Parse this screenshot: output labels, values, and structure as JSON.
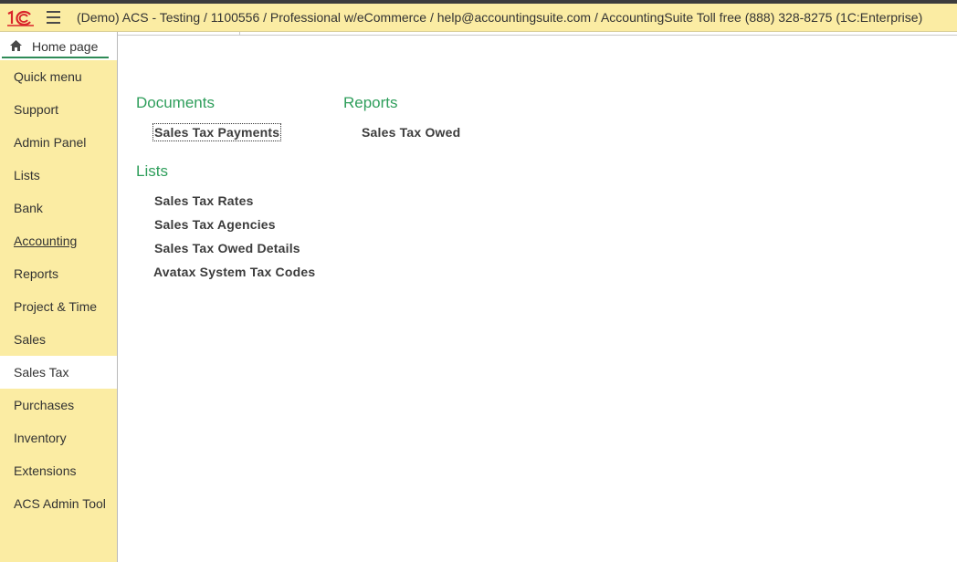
{
  "window": {
    "title": "(Demo) ACS - Testing / 1100556 / Professional w/eCommerce / help@accountingsuite.com / AccountingSuite Toll free (888) 328-8275  (1C:Enterprise)",
    "logo_icon": "1c-logo-icon",
    "menu_icon": "hamburger-menu-icon"
  },
  "sidebar": {
    "home": {
      "label": "Home page",
      "icon": "home-icon"
    },
    "items": [
      {
        "label": "Quick menu"
      },
      {
        "label": "Support"
      },
      {
        "label": "Admin Panel"
      },
      {
        "label": "Lists"
      },
      {
        "label": "Bank"
      },
      {
        "label": "Accounting"
      },
      {
        "label": "Reports"
      },
      {
        "label": "Project & Time"
      },
      {
        "label": "Sales"
      },
      {
        "label": "Sales Tax"
      },
      {
        "label": "Purchases"
      },
      {
        "label": "Inventory"
      },
      {
        "label": "Extensions"
      },
      {
        "label": "ACS Admin Tool"
      }
    ],
    "active_item": "Sales Tax"
  },
  "content": {
    "documents": {
      "heading": "Documents",
      "links": [
        "Sales Tax Payments"
      ]
    },
    "lists": {
      "heading": "Lists",
      "links": [
        "Sales Tax Rates",
        "Sales Tax Agencies",
        "Sales Tax Owed Details",
        "Avatax System Tax Codes"
      ]
    },
    "reports": {
      "heading": "Reports",
      "links": [
        "Sales Tax Owed"
      ]
    }
  },
  "colors": {
    "panel_yellow": "#fbeca3",
    "section_green": "#2e9e5b",
    "logo_red": "#d9232a"
  }
}
